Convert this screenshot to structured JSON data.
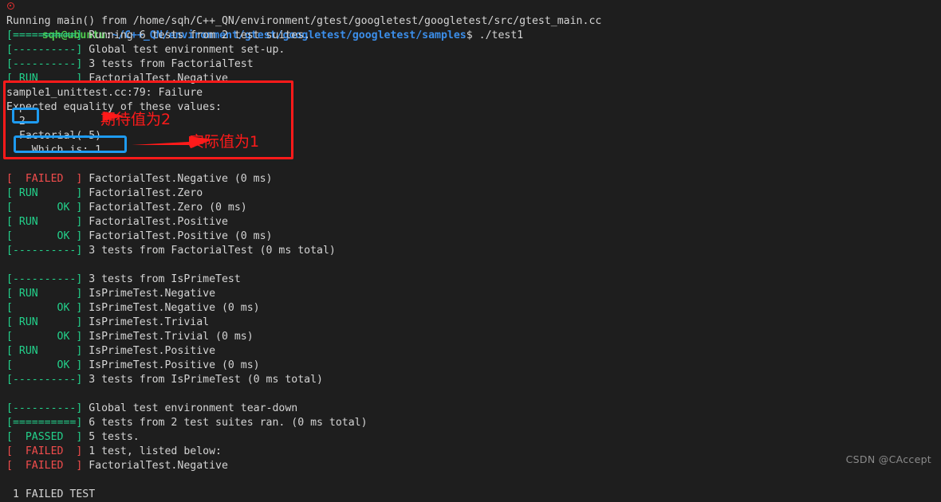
{
  "terminal": {
    "background": "#1e1e1e",
    "foreground": "#d4d4d4",
    "green": "#23d18b",
    "red": "#f14c4c",
    "prompt_user_color": "#4ec94e",
    "prompt_path_color": "#3b8eea"
  },
  "prompt": {
    "user_host": "sqh@ubuntu",
    "colon": ":",
    "path": "~/C++_QN/environment/gtest/googletest/googletest/samples",
    "dollar": "$",
    "command": "./test1",
    "error_icon": "error-circle-icon"
  },
  "lines": [
    {
      "text": "Running main() from /home/sqh/C++_QN/environment/gtest/googletest/googletest/src/gtest_main.cc",
      "color": "white"
    },
    {
      "tag": "[==========]",
      "tag_color": "green",
      "text": " Running 6 tests from 2 test suites.",
      "color": "white"
    },
    {
      "tag": "[----------]",
      "tag_color": "green",
      "text": " Global test environment set-up.",
      "color": "white"
    },
    {
      "tag": "[----------]",
      "tag_color": "green",
      "text": " 3 tests from FactorialTest",
      "color": "white"
    },
    {
      "tag": "[ RUN      ]",
      "tag_color": "green",
      "text": " FactorialTest.Negative",
      "color": "white"
    },
    {
      "text": "sample1_unittest.cc:79: Failure",
      "color": "white"
    },
    {
      "text": "Expected equality of these values:",
      "color": "white"
    },
    {
      "text": "  2",
      "color": "white"
    },
    {
      "text": "  Factorial(-5)",
      "color": "white"
    },
    {
      "text": "    Which is: 1",
      "color": "white"
    },
    {
      "text": "",
      "color": "white"
    },
    {
      "tag": "[  FAILED  ]",
      "tag_color": "red",
      "text": " FactorialTest.Negative (0 ms)",
      "color": "white"
    },
    {
      "tag": "[ RUN      ]",
      "tag_color": "green",
      "text": " FactorialTest.Zero",
      "color": "white"
    },
    {
      "tag": "[       OK ]",
      "tag_color": "green",
      "text": " FactorialTest.Zero (0 ms)",
      "color": "white"
    },
    {
      "tag": "[ RUN      ]",
      "tag_color": "green",
      "text": " FactorialTest.Positive",
      "color": "white"
    },
    {
      "tag": "[       OK ]",
      "tag_color": "green",
      "text": " FactorialTest.Positive (0 ms)",
      "color": "white"
    },
    {
      "tag": "[----------]",
      "tag_color": "green",
      "text": " 3 tests from FactorialTest (0 ms total)",
      "color": "white"
    },
    {
      "text": "",
      "color": "white"
    },
    {
      "tag": "[----------]",
      "tag_color": "green",
      "text": " 3 tests from IsPrimeTest",
      "color": "white"
    },
    {
      "tag": "[ RUN      ]",
      "tag_color": "green",
      "text": " IsPrimeTest.Negative",
      "color": "white"
    },
    {
      "tag": "[       OK ]",
      "tag_color": "green",
      "text": " IsPrimeTest.Negative (0 ms)",
      "color": "white"
    },
    {
      "tag": "[ RUN      ]",
      "tag_color": "green",
      "text": " IsPrimeTest.Trivial",
      "color": "white"
    },
    {
      "tag": "[       OK ]",
      "tag_color": "green",
      "text": " IsPrimeTest.Trivial (0 ms)",
      "color": "white"
    },
    {
      "tag": "[ RUN      ]",
      "tag_color": "green",
      "text": " IsPrimeTest.Positive",
      "color": "white"
    },
    {
      "tag": "[       OK ]",
      "tag_color": "green",
      "text": " IsPrimeTest.Positive (0 ms)",
      "color": "white"
    },
    {
      "tag": "[----------]",
      "tag_color": "green",
      "text": " 3 tests from IsPrimeTest (0 ms total)",
      "color": "white"
    },
    {
      "text": "",
      "color": "white"
    },
    {
      "tag": "[----------]",
      "tag_color": "green",
      "text": " Global test environment tear-down",
      "color": "white"
    },
    {
      "tag": "[==========]",
      "tag_color": "green",
      "text": " 6 tests from 2 test suites ran. (0 ms total)",
      "color": "white"
    },
    {
      "tag": "[  PASSED  ]",
      "tag_color": "green",
      "text": " 5 tests.",
      "color": "white"
    },
    {
      "tag": "[  FAILED  ]",
      "tag_color": "red",
      "text": " 1 test, listed below:",
      "color": "white"
    },
    {
      "tag": "[  FAILED  ]",
      "tag_color": "red",
      "text": " FactorialTest.Negative",
      "color": "white"
    },
    {
      "text": "",
      "color": "white"
    },
    {
      "text": " 1 FAILED TEST",
      "color": "white"
    }
  ],
  "annotations": {
    "red_box_color": "#ff1a1a",
    "blue_box_color": "#1e9bf0",
    "expected_label": "期待值为2",
    "actual_label": "实际值为1"
  },
  "watermark": {
    "text": "CSDN @CAccept"
  }
}
